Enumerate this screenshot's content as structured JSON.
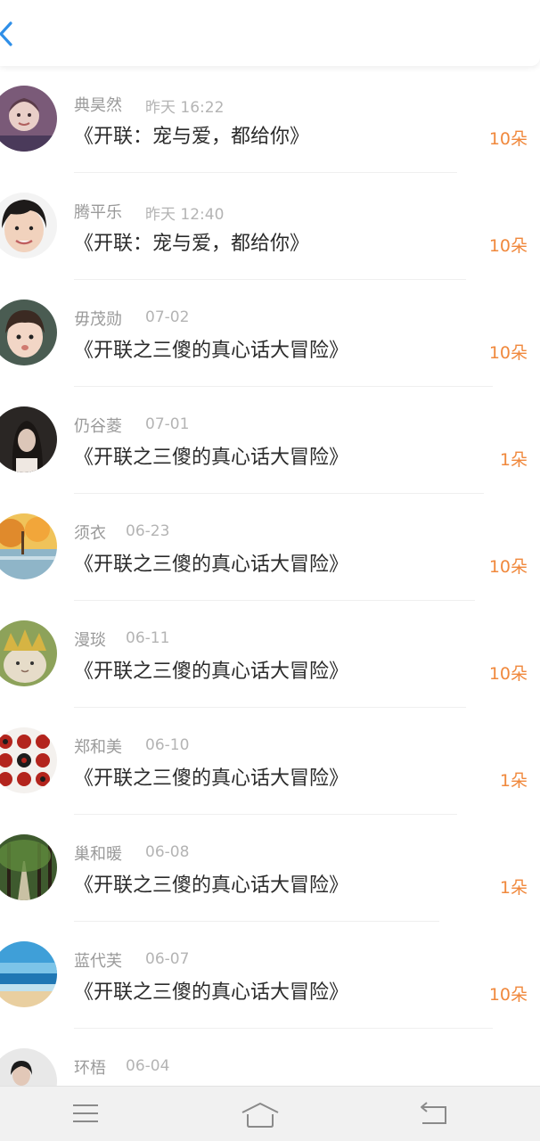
{
  "header": {
    "back_icon": "chevron-left-icon"
  },
  "accent_color": "#f0883c",
  "items": [
    {
      "name": "典昊然",
      "time": "昨天 16:22",
      "title": "《开联：宠与爱，都给你》",
      "count": "10朵"
    },
    {
      "name": "腾平乐",
      "time": "昨天 12:40",
      "title": "《开联：宠与爱，都给你》",
      "count": "10朵"
    },
    {
      "name": "毋茂勋",
      "time": "07-02",
      "title": "《开联之三傻的真心话大冒险》",
      "count": "10朵"
    },
    {
      "name": "仍谷菱",
      "time": "07-01",
      "title": "《开联之三傻的真心话大冒险》",
      "count": "1朵"
    },
    {
      "name": "须衣",
      "time": "06-23",
      "title": "《开联之三傻的真心话大冒险》",
      "count": "10朵"
    },
    {
      "name": "漫琰",
      "time": "06-11",
      "title": "《开联之三傻的真心话大冒险》",
      "count": "10朵"
    },
    {
      "name": "郑和美",
      "time": "06-10",
      "title": "《开联之三傻的真心话大冒险》",
      "count": "1朵"
    },
    {
      "name": "巢和暖",
      "time": "06-08",
      "title": "《开联之三傻的真心话大冒险》",
      "count": "1朵"
    },
    {
      "name": "蓝代芙",
      "time": "06-07",
      "title": "《开联之三傻的真心话大冒险》",
      "count": "10朵"
    },
    {
      "name": "环梧",
      "time": "06-04",
      "title": "",
      "count": ""
    }
  ],
  "navbar": {
    "menu_icon": "menu-icon",
    "home_icon": "home-icon",
    "back_icon": "back-arrow-icon"
  }
}
